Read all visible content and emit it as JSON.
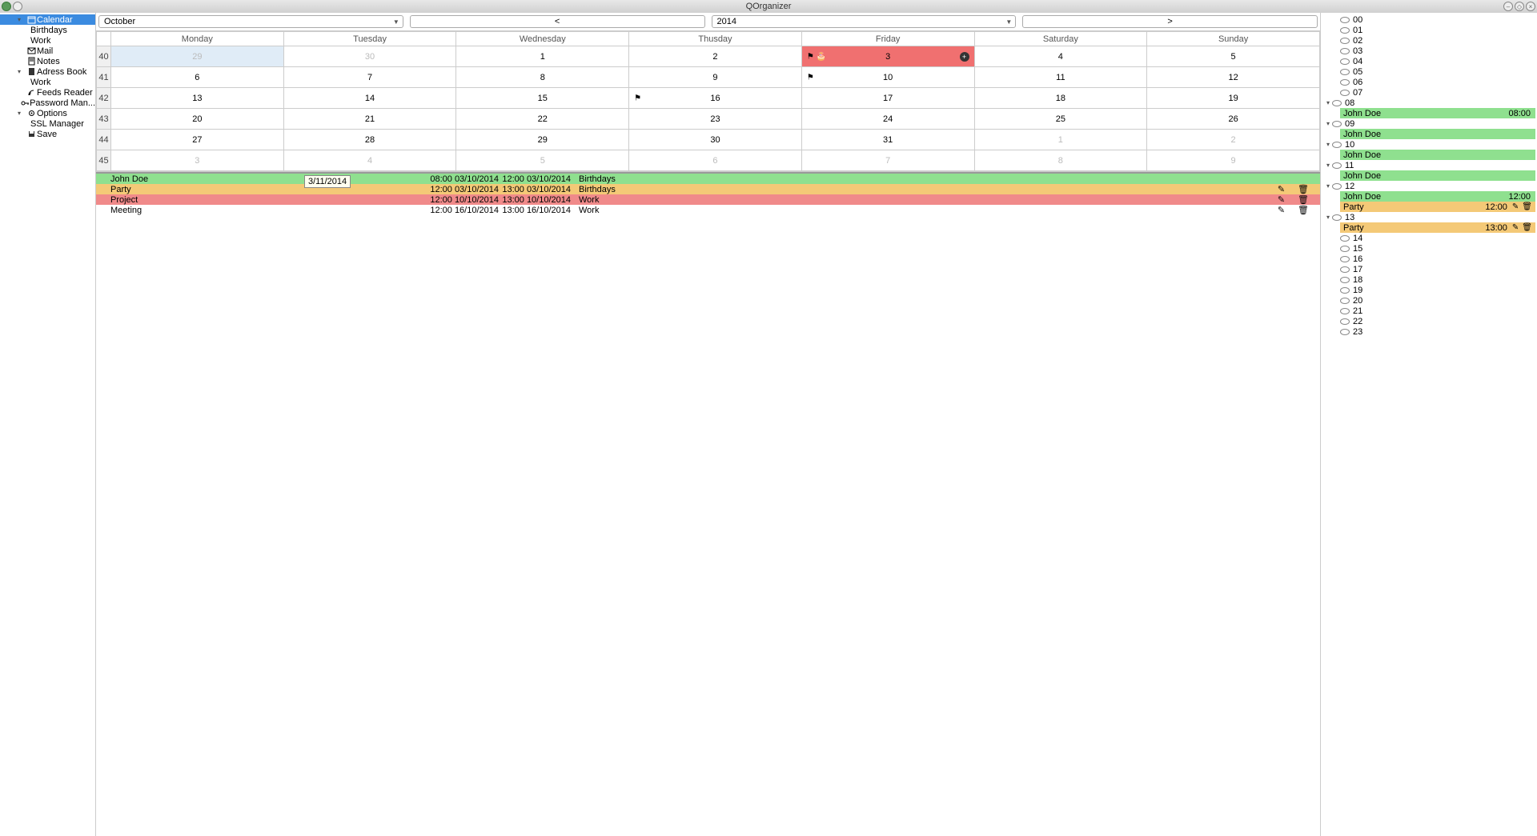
{
  "app": {
    "title": "QOrganizer"
  },
  "sidebar": {
    "items": [
      {
        "label": "Calendar"
      },
      {
        "label": "Birthdays"
      },
      {
        "label": "Work"
      },
      {
        "label": "Mail"
      },
      {
        "label": "Notes"
      },
      {
        "label": "Adress Book"
      },
      {
        "label": "Work"
      },
      {
        "label": "Feeds Reader"
      },
      {
        "label": "Password Man..."
      },
      {
        "label": "Options"
      },
      {
        "label": "SSL Manager"
      },
      {
        "label": "Save"
      }
    ]
  },
  "toolbar": {
    "month": "October",
    "year": "2014",
    "prev": "<",
    "next": ">"
  },
  "calendar": {
    "days": [
      "Monday",
      "Tuesday",
      "Wednesday",
      "Thusday",
      "Friday",
      "Saturday",
      "Sunday"
    ],
    "weeks": [
      {
        "no": "40",
        "cells": [
          {
            "d": "29",
            "dim": true,
            "selected": true
          },
          {
            "d": "30",
            "dim": true
          },
          {
            "d": "1"
          },
          {
            "d": "2"
          },
          {
            "d": "3",
            "today": true,
            "flag": true,
            "cake": true,
            "plus": true
          },
          {
            "d": "4"
          },
          {
            "d": "5"
          }
        ]
      },
      {
        "no": "41",
        "cells": [
          {
            "d": "6"
          },
          {
            "d": "7"
          },
          {
            "d": "8"
          },
          {
            "d": "9"
          },
          {
            "d": "10",
            "flag": true
          },
          {
            "d": "11"
          },
          {
            "d": "12"
          }
        ]
      },
      {
        "no": "42",
        "cells": [
          {
            "d": "13"
          },
          {
            "d": "14"
          },
          {
            "d": "15"
          },
          {
            "d": "16",
            "flag": true
          },
          {
            "d": "17"
          },
          {
            "d": "18"
          },
          {
            "d": "19"
          }
        ]
      },
      {
        "no": "43",
        "cells": [
          {
            "d": "20"
          },
          {
            "d": "21"
          },
          {
            "d": "22"
          },
          {
            "d": "23"
          },
          {
            "d": "24"
          },
          {
            "d": "25"
          },
          {
            "d": "26"
          }
        ]
      },
      {
        "no": "44",
        "cells": [
          {
            "d": "27"
          },
          {
            "d": "28"
          },
          {
            "d": "29"
          },
          {
            "d": "30"
          },
          {
            "d": "31"
          },
          {
            "d": "1",
            "dim": true
          },
          {
            "d": "2",
            "dim": true
          }
        ]
      },
      {
        "no": "45",
        "cells": [
          {
            "d": "3",
            "dim": true
          },
          {
            "d": "4",
            "dim": true
          },
          {
            "d": "5",
            "dim": true
          },
          {
            "d": "6",
            "dim": true
          },
          {
            "d": "7",
            "dim": true
          },
          {
            "d": "8",
            "dim": true
          },
          {
            "d": "9",
            "dim": true
          }
        ]
      }
    ]
  },
  "tooltip": "3/11/2014",
  "events": [
    {
      "name": "John Doe",
      "start": "08:00 03/10/2014",
      "end": "12:00 03/10/2014",
      "cat": "Birthdays",
      "color": "green",
      "editable": false
    },
    {
      "name": "Party",
      "start": "12:00 03/10/2014",
      "end": "13:00 03/10/2014",
      "cat": "Birthdays",
      "color": "orange",
      "editable": true
    },
    {
      "name": "Project",
      "start": "12:00 10/10/2014",
      "end": "13:00 10/10/2014",
      "cat": "Work",
      "color": "red",
      "editable": true
    },
    {
      "name": "Meeting",
      "start": "12:00 16/10/2014",
      "end": "13:00 16/10/2014",
      "cat": "Work",
      "color": "",
      "editable": true
    }
  ],
  "hours": [
    {
      "h": "00"
    },
    {
      "h": "01"
    },
    {
      "h": "02"
    },
    {
      "h": "03"
    },
    {
      "h": "04"
    },
    {
      "h": "05"
    },
    {
      "h": "06"
    },
    {
      "h": "07"
    },
    {
      "h": "08",
      "exp": true,
      "events": [
        {
          "name": "John Doe",
          "time": "08:00",
          "color": "green"
        }
      ]
    },
    {
      "h": "09",
      "exp": true,
      "events": [
        {
          "name": "John Doe",
          "color": "green"
        }
      ]
    },
    {
      "h": "10",
      "exp": true,
      "events": [
        {
          "name": "John Doe",
          "color": "green"
        }
      ]
    },
    {
      "h": "11",
      "exp": true,
      "events": [
        {
          "name": "John Doe",
          "color": "green"
        }
      ]
    },
    {
      "h": "12",
      "exp": true,
      "events": [
        {
          "name": "John Doe",
          "time": "12:00",
          "color": "green"
        },
        {
          "name": "Party",
          "time": "12:00",
          "color": "orange",
          "editable": true
        }
      ]
    },
    {
      "h": "13",
      "exp": true,
      "events": [
        {
          "name": "Party",
          "time": "13:00",
          "color": "orange",
          "editable": true
        }
      ]
    },
    {
      "h": "14"
    },
    {
      "h": "15"
    },
    {
      "h": "16"
    },
    {
      "h": "17"
    },
    {
      "h": "18"
    },
    {
      "h": "19"
    },
    {
      "h": "20"
    },
    {
      "h": "21"
    },
    {
      "h": "22"
    },
    {
      "h": "23"
    }
  ]
}
